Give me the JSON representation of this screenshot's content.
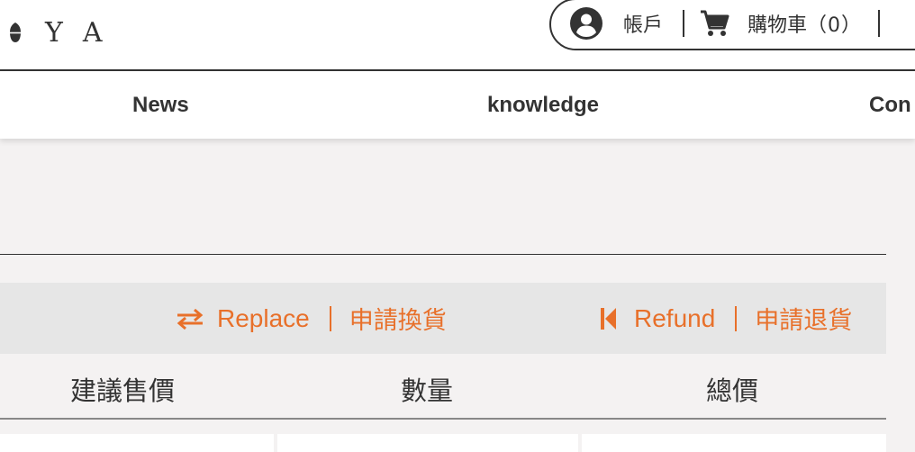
{
  "brand": {
    "letters": [
      "Y",
      "A"
    ],
    "icon": "bean-icon"
  },
  "account_bar": {
    "account_label": "帳戶",
    "account_icon": "user-circle-icon",
    "cart_label": "購物車",
    "cart_count": "（0）",
    "cart_icon": "shopping-cart-icon"
  },
  "nav": {
    "items": [
      "News",
      "knowledge",
      "Con"
    ]
  },
  "actions": {
    "replace": {
      "icon": "swap-arrows-icon",
      "label_en": "Replace",
      "label_zh": "申請換貨"
    },
    "refund": {
      "icon": "skip-back-icon",
      "label_en": "Refund",
      "label_zh": "申請退貨"
    }
  },
  "table": {
    "headers": [
      "建議售價",
      "數量",
      "總價"
    ]
  },
  "colors": {
    "accent": "#e8702a",
    "text": "#333333",
    "action_bar_bg": "#e6e6e6",
    "page_bg": "#f4f2f2"
  }
}
